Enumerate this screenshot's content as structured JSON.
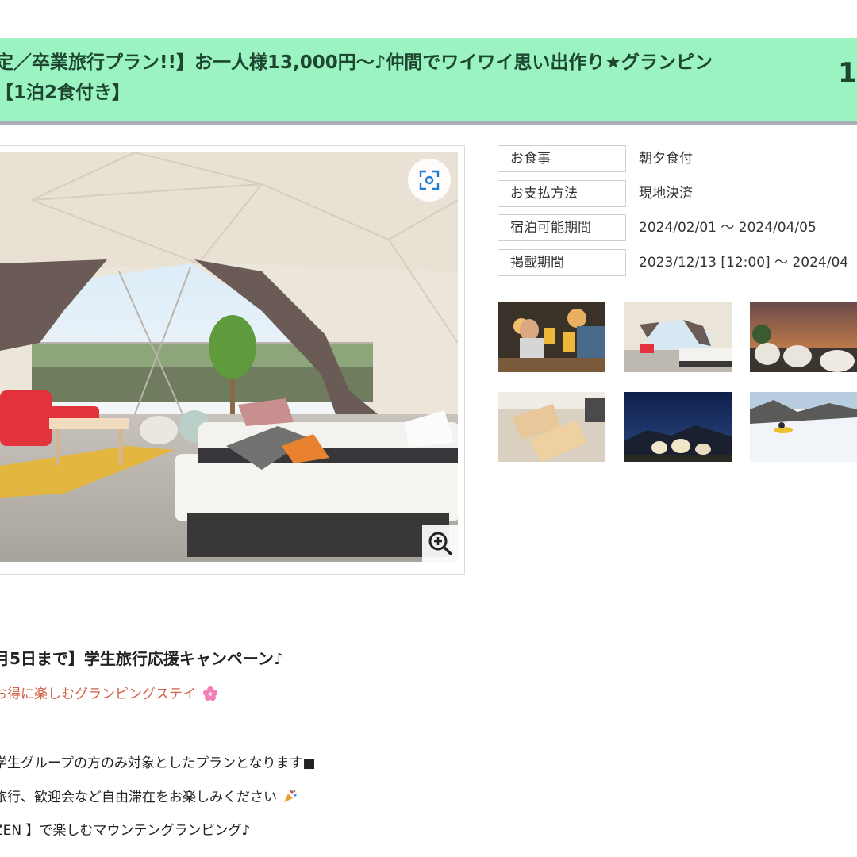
{
  "plan": {
    "title_line1": "定／卒業旅行プラン!!】お一人様13,000円～♪仲間でワイワイ思い出作り★グランピン",
    "title_line2": "【1泊2食付き】",
    "price_partial": "1"
  },
  "details": [
    {
      "label": "お食事",
      "value": "朝夕食付"
    },
    {
      "label": "お支払方法",
      "value": "現地決済"
    },
    {
      "label": "宿泊可能期間",
      "value": "2024/02/01 ～ 2024/04/05"
    },
    {
      "label": "掲載期間",
      "value": "2023/12/13 [12:00] ～ 2024/04"
    }
  ],
  "thumbnails": [
    "people-toasting",
    "dome-interior",
    "domes-at-dusk",
    "hot-sandwich",
    "domes-at-night",
    "snow-sledding"
  ],
  "description": {
    "heading": "月5日まで】学生旅行応援キャンペーン♪",
    "subheading": "お得に楽しむグランピングステイ",
    "subheading_icon": "cherry-blossom-icon",
    "lines": [
      "学生グループの方のみ対象としたプランとなります■",
      "旅行、歓迎会など自由滞在をお楽しみください",
      "ZEN 】で楽しむマウンテングランピング♪"
    ],
    "line2_icon": "party-popper-icon"
  },
  "colors": {
    "banner_bg": "#9af3c0",
    "banner_text": "#1e4631",
    "subheading_text": "#d0624a"
  }
}
